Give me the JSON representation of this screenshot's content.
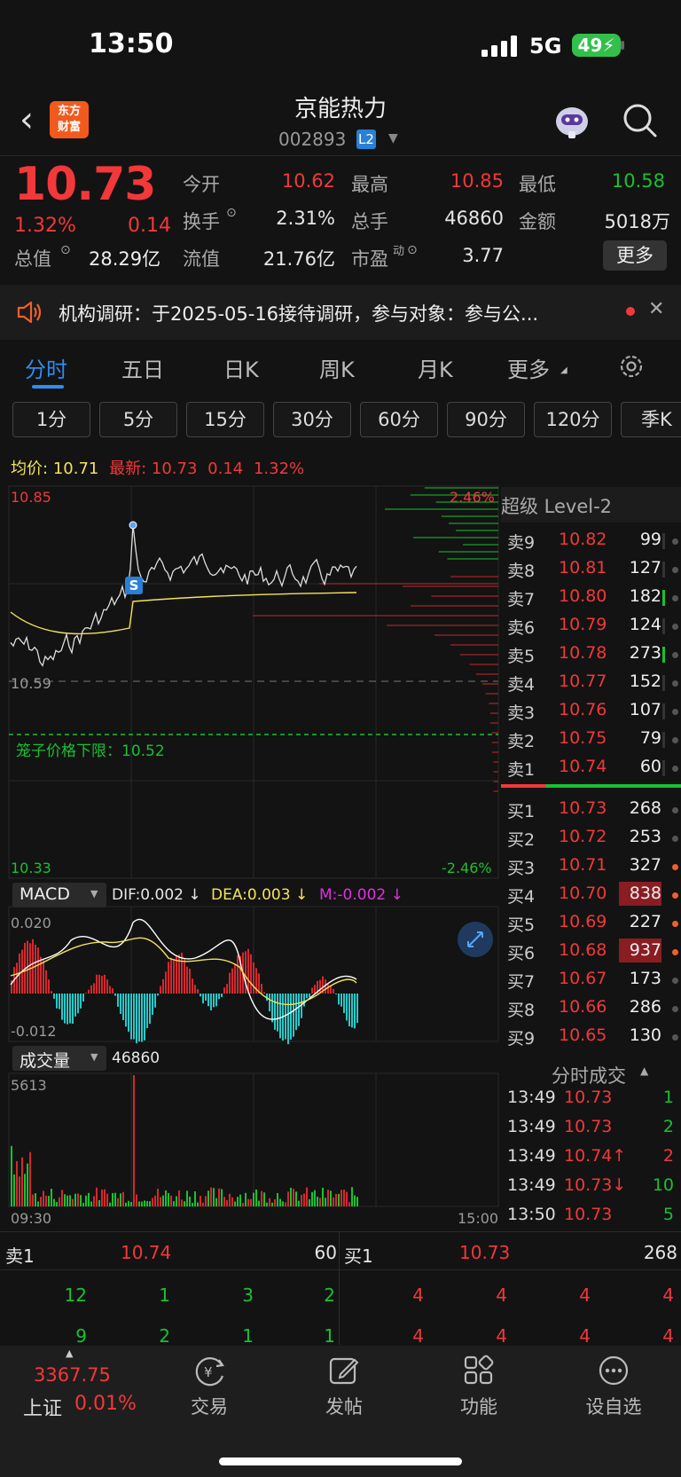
{
  "status_bar": {
    "time": "13:50",
    "network": "5G",
    "battery": "49"
  },
  "header": {
    "logo_line1": "东方",
    "logo_line2": "财富",
    "name": "京能热力",
    "code": "002893",
    "badge": "L2"
  },
  "quote": {
    "price": "10.73",
    "pct": "1.32%",
    "change": "0.14",
    "fields": [
      {
        "label": "今开",
        "value": "10.62",
        "color": "#f2383a"
      },
      {
        "label": "最高",
        "value": "10.85",
        "color": "#f2383a"
      },
      {
        "label": "最低",
        "value": "10.58",
        "color": "#18c132"
      },
      {
        "label": "换手",
        "value": "2.31%",
        "color": "#e6e6e6"
      },
      {
        "label": "总手",
        "value": "46860",
        "color": "#e6e6e6"
      },
      {
        "label": "金额",
        "value": "5018万",
        "color": "#e6e6e6"
      },
      {
        "label": "流值",
        "value": "21.76亿",
        "color": "#e6e6e6"
      },
      {
        "label": "市盈",
        "value": "3.77",
        "color": "#e6e6e6"
      }
    ],
    "market_cap_label": "总值",
    "market_cap": "28.29亿",
    "pe_superscript": "动",
    "more": "更多"
  },
  "news": {
    "text": "机构调研：于2025-05-16接待调研，参与对象：参与公..."
  },
  "tabs": [
    "分时",
    "五日",
    "日K",
    "周K",
    "月K",
    "更多"
  ],
  "intervals": [
    "1分",
    "5分",
    "15分",
    "30分",
    "60分",
    "90分",
    "120分",
    "季K"
  ],
  "intraday": {
    "avg_label": "均价:",
    "avg_value": "10.71",
    "latest_label": "最新:",
    "latest_value": "10.73",
    "latest_change": "0.14",
    "latest_pct": "1.32%",
    "y_high": "10.85",
    "y_low": "10.33",
    "prev_close": "10.59",
    "pct_high": "2.46%",
    "pct_low": "-2.46%",
    "cage_label": "笼子价格下限：10.52",
    "marker": "S",
    "time_start": "09:30",
    "time_end": "15:00"
  },
  "macd": {
    "name": "MACD",
    "dif": "DIF:0.002 ↓",
    "dea": "DEA:0.003 ↓",
    "m": "M:-0.002 ↓",
    "top": "0.020",
    "bottom": "-0.012"
  },
  "volume": {
    "name": "成交量",
    "total": "46860",
    "max": "5613"
  },
  "level2": {
    "title": "超级 Level-2",
    "asks": [
      {
        "label": "卖9",
        "price": "10.82",
        "vol": "99"
      },
      {
        "label": "卖8",
        "price": "10.81",
        "vol": "127"
      },
      {
        "label": "卖7",
        "price": "10.80",
        "vol": "182"
      },
      {
        "label": "卖6",
        "price": "10.79",
        "vol": "124"
      },
      {
        "label": "卖5",
        "price": "10.78",
        "vol": "273"
      },
      {
        "label": "卖4",
        "price": "10.77",
        "vol": "152"
      },
      {
        "label": "卖3",
        "price": "10.76",
        "vol": "107"
      },
      {
        "label": "卖2",
        "price": "10.75",
        "vol": "79"
      },
      {
        "label": "卖1",
        "price": "10.74",
        "vol": "60"
      }
    ],
    "bids": [
      {
        "label": "买1",
        "price": "10.73",
        "vol": "268"
      },
      {
        "label": "买2",
        "price": "10.72",
        "vol": "253"
      },
      {
        "label": "买3",
        "price": "10.71",
        "vol": "327"
      },
      {
        "label": "买4",
        "price": "10.70",
        "vol": "838"
      },
      {
        "label": "买5",
        "price": "10.69",
        "vol": "227"
      },
      {
        "label": "买6",
        "price": "10.68",
        "vol": "937"
      },
      {
        "label": "买7",
        "price": "10.67",
        "vol": "173"
      },
      {
        "label": "买8",
        "price": "10.66",
        "vol": "286"
      },
      {
        "label": "买9",
        "price": "10.65",
        "vol": "130"
      }
    ]
  },
  "ticks": {
    "title": "分时成交",
    "rows": [
      {
        "time": "13:49",
        "price": "10.73",
        "vol": "1",
        "pc": "#f2383a",
        "vc": "#18c132"
      },
      {
        "time": "13:49",
        "price": "10.73",
        "vol": "2",
        "pc": "#f2383a",
        "vc": "#18c132"
      },
      {
        "time": "13:49",
        "price": "10.74↑",
        "vol": "2",
        "pc": "#f2383a",
        "vc": "#f2383a"
      },
      {
        "time": "13:49",
        "price": "10.73↓",
        "vol": "10",
        "pc": "#f2383a",
        "vc": "#18c132"
      },
      {
        "time": "13:50",
        "price": "10.73",
        "vol": "5",
        "pc": "#f2383a",
        "vc": "#18c132"
      }
    ]
  },
  "summary": {
    "sell_label": "卖1",
    "sell_price": "10.74",
    "sell_vol": "60",
    "buy_label": "买1",
    "buy_price": "10.73",
    "buy_vol": "268",
    "sell_row1": [
      "12",
      "1",
      "3",
      "2"
    ],
    "sell_row2": [
      "9",
      "2",
      "1",
      "1"
    ],
    "buy_row1": [
      "4",
      "4",
      "4",
      "4"
    ],
    "buy_row2": [
      "4",
      "4",
      "4",
      "4"
    ]
  },
  "nav": {
    "index_value": "3367.75",
    "index_name": "上证",
    "index_pct": "0.01%",
    "items": [
      "交易",
      "发帖",
      "功能",
      "设自选"
    ]
  },
  "colors": {
    "up": "#f2383a",
    "down": "#18c132",
    "avg": "#f3e35a",
    "accent": "#2f8cf0"
  }
}
